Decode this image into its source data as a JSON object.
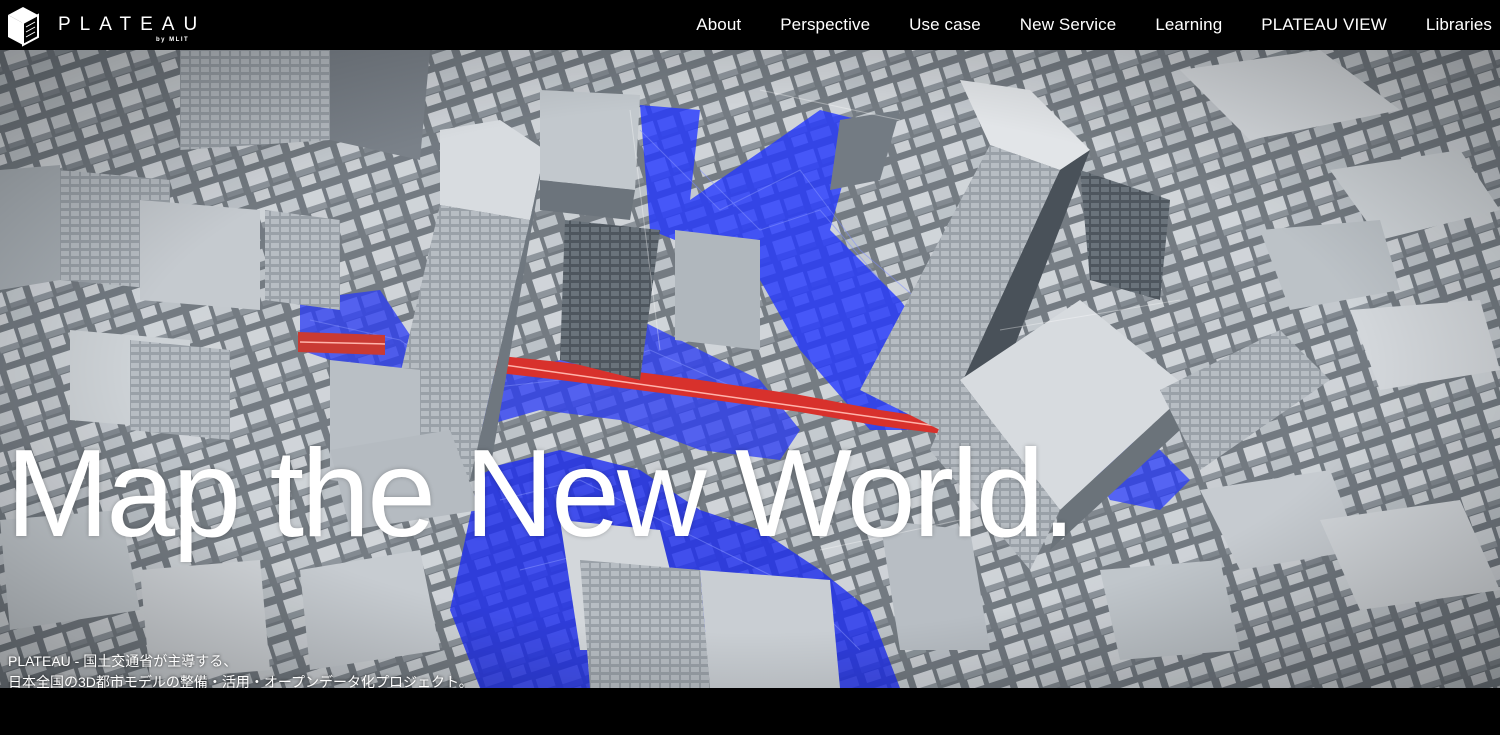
{
  "brand": {
    "logo_text": "PLATEAU",
    "logo_subtext": "by MLIT"
  },
  "nav": {
    "items": [
      {
        "label": "About"
      },
      {
        "label": "Perspective"
      },
      {
        "label": "Use case"
      },
      {
        "label": "New Service"
      },
      {
        "label": "Learning"
      },
      {
        "label": "PLATEAU VIEW"
      },
      {
        "label": "Libraries"
      }
    ]
  },
  "hero": {
    "headline": "Map the New World.",
    "tagline_line1": "PLATEAU - 国土交通省が主導する、",
    "tagline_line2": "日本全国の3D都市モデルの整備・活用・オープンデータ化プロジェクト。"
  },
  "colors": {
    "header_bg": "#000000",
    "text": "#ffffff",
    "route_blue": "#2438ff",
    "rail_red": "#d8312c",
    "building_grey": "#c9ced3"
  }
}
